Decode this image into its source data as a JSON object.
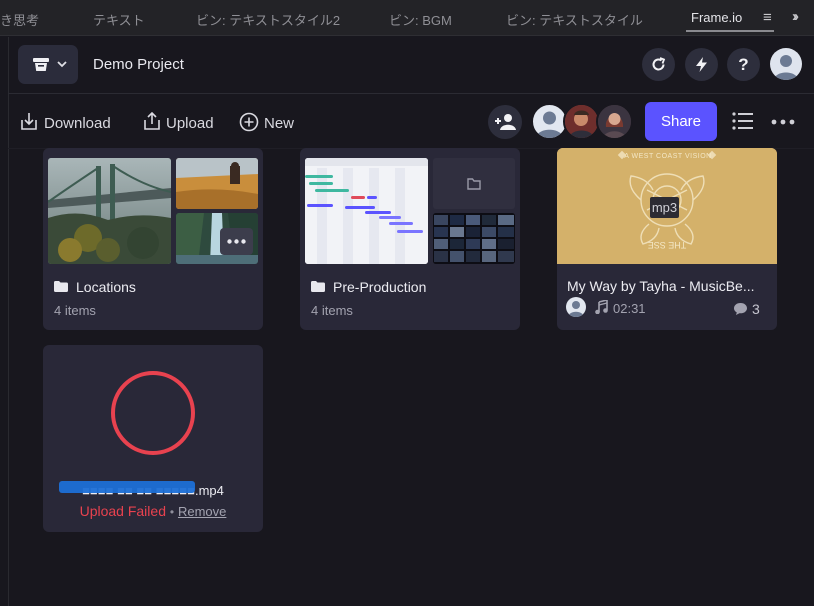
{
  "tabs": [
    {
      "label": "き思考"
    },
    {
      "label": "テキスト"
    },
    {
      "label": "ビン: テキストスタイル2"
    },
    {
      "label": "ビン: BGM"
    },
    {
      "label": "ビン: テキストスタイル"
    },
    {
      "label": "Frame.io"
    }
  ],
  "header": {
    "project_title": "Demo Project",
    "help_label": "?"
  },
  "toolbar": {
    "download_label": "Download",
    "upload_label": "Upload",
    "new_label": "New",
    "share_label": "Share"
  },
  "cards": {
    "locations": {
      "title": "Locations",
      "subtitle": "4 items"
    },
    "preproduction": {
      "title": "Pre-Production",
      "subtitle": "4 items"
    },
    "audio": {
      "title": "My Way by Tayha - MusicBe...",
      "badge": "mp3",
      "duration": "02:31",
      "comments": "3",
      "cover_top_text": "A WEST COAST VISION",
      "cover_bottom_text": "THE SSE"
    },
    "failed": {
      "filename": "■■■■ ■■ ■■ ■■■■■.mp4",
      "status": "Upload Failed",
      "separator": "•",
      "remove_label": "Remove"
    }
  },
  "colors": {
    "accent": "#5b53ff",
    "error": "#e8424f",
    "card": "#292838",
    "background": "#18171e"
  }
}
